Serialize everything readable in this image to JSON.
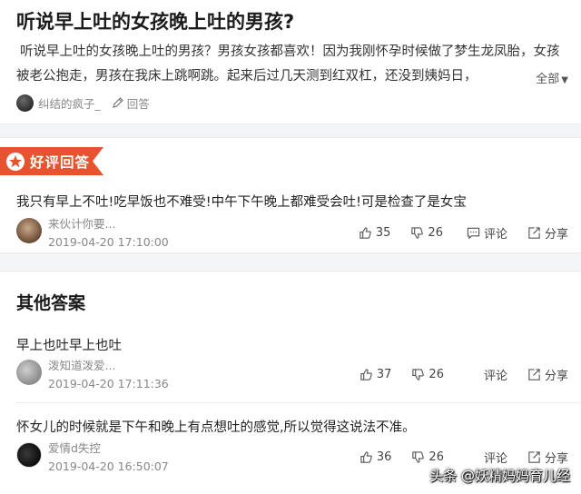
{
  "question": {
    "title": "听说早上吐的女孩晚上吐的男孩?",
    "description": "听说早上吐的女孩晚上吐的男孩？男孩女孩都喜欢！因为我刚怀孕时候做了梦生龙凤胎，女孩被老公抱走，男孩在我床上跳啊跳。起来后过几天测到红双杠，还没到姨妈日，",
    "more_label": "全部",
    "author": "纠结的疯子_",
    "reply_label": "回答"
  },
  "best_answer": {
    "badge_label": "好评回答",
    "badge_color": "#e8532f",
    "text": "我只有早上不吐!吃早饭也不难受!中午下午晚上都难受会吐!可是检查了是女宝",
    "author": "来伙计你要...",
    "time": "2019-04-20 17:10:00",
    "likes": "35",
    "dislikes": "26",
    "comment_label": "评论",
    "share_label": "分享"
  },
  "other_answers": {
    "section_title": "其他答案",
    "items": [
      {
        "text": "早上也吐早上也吐",
        "author": "泼知道泼爱...",
        "time": "2019-04-20 17:11:36",
        "likes": "37",
        "dislikes": "26",
        "comment_label": "评论",
        "share_label": "分享"
      },
      {
        "text": "怀女儿的时候就是下午和晚上有点想吐的感觉,所以觉得这说法不准。",
        "author": "爱情d失控",
        "time": "2019-04-20 16:50:07",
        "likes": "36",
        "dislikes": "26",
        "comment_label": "评论",
        "share_label": "分享"
      }
    ]
  },
  "watermark": "头条 @妖精妈妈育儿经"
}
